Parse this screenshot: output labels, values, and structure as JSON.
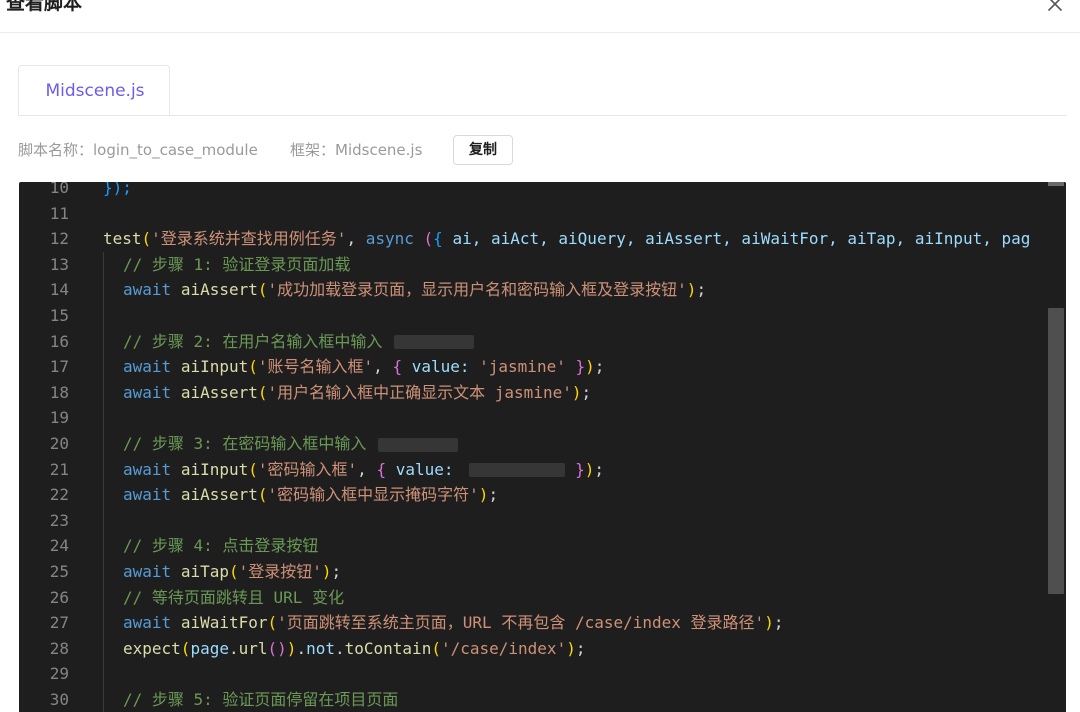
{
  "dialog": {
    "title": "查看脚本",
    "close_icon": "close-icon"
  },
  "tabs": [
    {
      "label": "Midscene.js",
      "active": true
    }
  ],
  "meta": {
    "script_name": "脚本名称：login_to_case_module",
    "framework": "框架：Midscene.js",
    "copy_label": "复制"
  },
  "editor": {
    "lines": [
      {
        "num": "10",
        "text": "});"
      },
      {
        "num": "11",
        "text": ""
      },
      {
        "num": "12",
        "text": "test('登录系统并查找用例任务', async ({ ai, aiAct, aiQuery, aiAssert, aiWaitFor, aiTap, aiInput, pag"
      },
      {
        "num": "13",
        "text": "  // 步骤 1: 验证登录页面加载"
      },
      {
        "num": "14",
        "text": "  await aiAssert('成功加载登录页面，显示用户名和密码输入框及登录按钮');"
      },
      {
        "num": "15",
        "text": ""
      },
      {
        "num": "16",
        "text": "  // 步骤 2: 在用户名输入框中输入"
      },
      {
        "num": "17",
        "text": "  await aiInput('账号名输入框', { value: 'jasmine' });"
      },
      {
        "num": "18",
        "text": "  await aiAssert('用户名输入框中正确显示文本 jasmine');"
      },
      {
        "num": "19",
        "text": ""
      },
      {
        "num": "20",
        "text": "  // 步骤 3: 在密码输入框中输入"
      },
      {
        "num": "21",
        "text": "  await aiInput('密码输入框', { value:"
      },
      {
        "num": "22",
        "text": "  await aiAssert('密码输入框中显示掩码字符');"
      },
      {
        "num": "23",
        "text": ""
      },
      {
        "num": "24",
        "text": "  // 步骤 4: 点击登录按钮"
      },
      {
        "num": "25",
        "text": "  await aiTap('登录按钮');"
      },
      {
        "num": "26",
        "text": "  // 等待页面跳转且 URL 变化"
      },
      {
        "num": "27",
        "text": "  await aiWaitFor('页面跳转至系统主页面，URL 不再包含 /case/index 登录路径');"
      },
      {
        "num": "28",
        "text": "  expect(page.url()).not.toContain('/case/index');"
      },
      {
        "num": "29",
        "text": ""
      },
      {
        "num": "30",
        "text": "  // 步骤 5: 验证页面停留在项目页面"
      }
    ],
    "tokens": {
      "l10": [
        "});"
      ],
      "l12": [
        "test",
        "(",
        "'登录系统并查找用例任务'",
        ", ",
        "async",
        " ",
        "(",
        "{",
        " ai, aiAct, aiQuery, aiAssert, aiWaitFor, aiTap, aiInput, pag"
      ],
      "l13": [
        "// 步骤 1: 验证登录页面加载"
      ],
      "l14": [
        "await",
        " ",
        "aiAssert",
        "(",
        "'成功加载登录页面，显示用户名和密码输入框及登录按钮'",
        ")",
        ";"
      ],
      "l16": [
        "// 步骤 2: 在用户名输入框中输入"
      ],
      "l17": [
        "await",
        " ",
        "aiInput",
        "(",
        "'账号名输入框'",
        ", ",
        "{",
        " value: ",
        "'jasmine'",
        " ",
        "}",
        ")",
        ";"
      ],
      "l18": [
        "await",
        " ",
        "aiAssert",
        "(",
        "'用户名输入框中正确显示文本 jasmine'",
        ")",
        ";"
      ],
      "l20": [
        "// 步骤 3: 在密码输入框中输入"
      ],
      "l21": [
        "await",
        " ",
        "aiInput",
        "(",
        "'密码输入框'",
        ", ",
        "{",
        " value: ",
        "}",
        ")",
        ";"
      ],
      "l22": [
        "await",
        " ",
        "aiAssert",
        "(",
        "'密码输入框中显示掩码字符'",
        ")",
        ";"
      ],
      "l24": [
        "// 步骤 4: 点击登录按钮"
      ],
      "l25": [
        "await",
        " ",
        "aiTap",
        "(",
        "'登录按钮'",
        ")",
        ";"
      ],
      "l26": [
        "// 等待页面跳转且 URL 变化"
      ],
      "l27": [
        "await",
        " ",
        "aiWaitFor",
        "(",
        "'页面跳转至系统主页面，URL 不再包含 /case/index 登录路径'",
        ")",
        ";"
      ],
      "l28": [
        "expect",
        "(",
        "page",
        ".",
        "url",
        "(",
        ")",
        ")",
        ".",
        "not",
        ".",
        "toContain",
        "(",
        "'/case/index'",
        ")",
        ";"
      ],
      "l30": [
        "// 步骤 5: 验证页面停留在项目页面"
      ]
    }
  }
}
